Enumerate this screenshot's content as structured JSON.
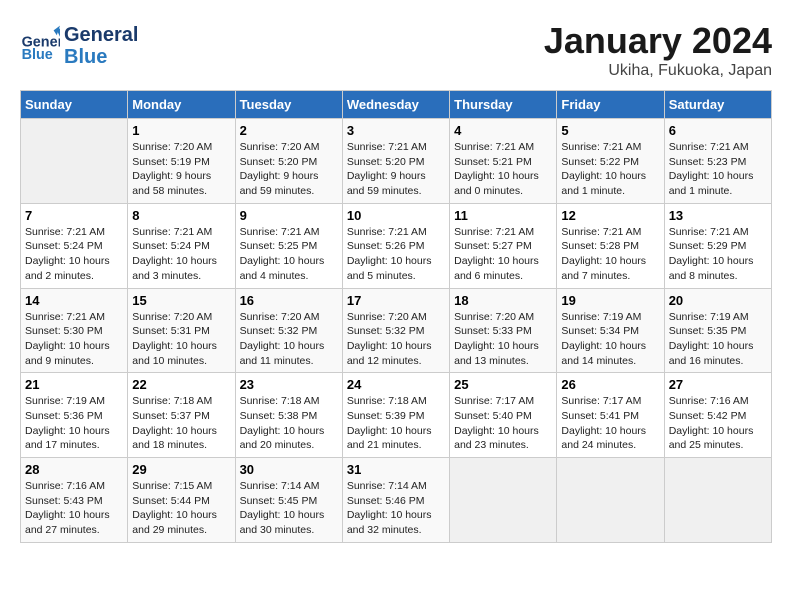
{
  "header": {
    "logo_general": "General",
    "logo_blue": "Blue",
    "title": "January 2024",
    "subtitle": "Ukiha, Fukuoka, Japan"
  },
  "columns": [
    "Sunday",
    "Monday",
    "Tuesday",
    "Wednesday",
    "Thursday",
    "Friday",
    "Saturday"
  ],
  "weeks": [
    [
      {
        "day": "",
        "info": ""
      },
      {
        "day": "1",
        "info": "Sunrise: 7:20 AM\nSunset: 5:19 PM\nDaylight: 9 hours\nand 58 minutes."
      },
      {
        "day": "2",
        "info": "Sunrise: 7:20 AM\nSunset: 5:20 PM\nDaylight: 9 hours\nand 59 minutes."
      },
      {
        "day": "3",
        "info": "Sunrise: 7:21 AM\nSunset: 5:20 PM\nDaylight: 9 hours\nand 59 minutes."
      },
      {
        "day": "4",
        "info": "Sunrise: 7:21 AM\nSunset: 5:21 PM\nDaylight: 10 hours\nand 0 minutes."
      },
      {
        "day": "5",
        "info": "Sunrise: 7:21 AM\nSunset: 5:22 PM\nDaylight: 10 hours\nand 1 minute."
      },
      {
        "day": "6",
        "info": "Sunrise: 7:21 AM\nSunset: 5:23 PM\nDaylight: 10 hours\nand 1 minute."
      }
    ],
    [
      {
        "day": "7",
        "info": "Sunrise: 7:21 AM\nSunset: 5:24 PM\nDaylight: 10 hours\nand 2 minutes."
      },
      {
        "day": "8",
        "info": "Sunrise: 7:21 AM\nSunset: 5:24 PM\nDaylight: 10 hours\nand 3 minutes."
      },
      {
        "day": "9",
        "info": "Sunrise: 7:21 AM\nSunset: 5:25 PM\nDaylight: 10 hours\nand 4 minutes."
      },
      {
        "day": "10",
        "info": "Sunrise: 7:21 AM\nSunset: 5:26 PM\nDaylight: 10 hours\nand 5 minutes."
      },
      {
        "day": "11",
        "info": "Sunrise: 7:21 AM\nSunset: 5:27 PM\nDaylight: 10 hours\nand 6 minutes."
      },
      {
        "day": "12",
        "info": "Sunrise: 7:21 AM\nSunset: 5:28 PM\nDaylight: 10 hours\nand 7 minutes."
      },
      {
        "day": "13",
        "info": "Sunrise: 7:21 AM\nSunset: 5:29 PM\nDaylight: 10 hours\nand 8 minutes."
      }
    ],
    [
      {
        "day": "14",
        "info": "Sunrise: 7:21 AM\nSunset: 5:30 PM\nDaylight: 10 hours\nand 9 minutes."
      },
      {
        "day": "15",
        "info": "Sunrise: 7:20 AM\nSunset: 5:31 PM\nDaylight: 10 hours\nand 10 minutes."
      },
      {
        "day": "16",
        "info": "Sunrise: 7:20 AM\nSunset: 5:32 PM\nDaylight: 10 hours\nand 11 minutes."
      },
      {
        "day": "17",
        "info": "Sunrise: 7:20 AM\nSunset: 5:32 PM\nDaylight: 10 hours\nand 12 minutes."
      },
      {
        "day": "18",
        "info": "Sunrise: 7:20 AM\nSunset: 5:33 PM\nDaylight: 10 hours\nand 13 minutes."
      },
      {
        "day": "19",
        "info": "Sunrise: 7:19 AM\nSunset: 5:34 PM\nDaylight: 10 hours\nand 14 minutes."
      },
      {
        "day": "20",
        "info": "Sunrise: 7:19 AM\nSunset: 5:35 PM\nDaylight: 10 hours\nand 16 minutes."
      }
    ],
    [
      {
        "day": "21",
        "info": "Sunrise: 7:19 AM\nSunset: 5:36 PM\nDaylight: 10 hours\nand 17 minutes."
      },
      {
        "day": "22",
        "info": "Sunrise: 7:18 AM\nSunset: 5:37 PM\nDaylight: 10 hours\nand 18 minutes."
      },
      {
        "day": "23",
        "info": "Sunrise: 7:18 AM\nSunset: 5:38 PM\nDaylight: 10 hours\nand 20 minutes."
      },
      {
        "day": "24",
        "info": "Sunrise: 7:18 AM\nSunset: 5:39 PM\nDaylight: 10 hours\nand 21 minutes."
      },
      {
        "day": "25",
        "info": "Sunrise: 7:17 AM\nSunset: 5:40 PM\nDaylight: 10 hours\nand 23 minutes."
      },
      {
        "day": "26",
        "info": "Sunrise: 7:17 AM\nSunset: 5:41 PM\nDaylight: 10 hours\nand 24 minutes."
      },
      {
        "day": "27",
        "info": "Sunrise: 7:16 AM\nSunset: 5:42 PM\nDaylight: 10 hours\nand 25 minutes."
      }
    ],
    [
      {
        "day": "28",
        "info": "Sunrise: 7:16 AM\nSunset: 5:43 PM\nDaylight: 10 hours\nand 27 minutes."
      },
      {
        "day": "29",
        "info": "Sunrise: 7:15 AM\nSunset: 5:44 PM\nDaylight: 10 hours\nand 29 minutes."
      },
      {
        "day": "30",
        "info": "Sunrise: 7:14 AM\nSunset: 5:45 PM\nDaylight: 10 hours\nand 30 minutes."
      },
      {
        "day": "31",
        "info": "Sunrise: 7:14 AM\nSunset: 5:46 PM\nDaylight: 10 hours\nand 32 minutes."
      },
      {
        "day": "",
        "info": ""
      },
      {
        "day": "",
        "info": ""
      },
      {
        "day": "",
        "info": ""
      }
    ]
  ]
}
